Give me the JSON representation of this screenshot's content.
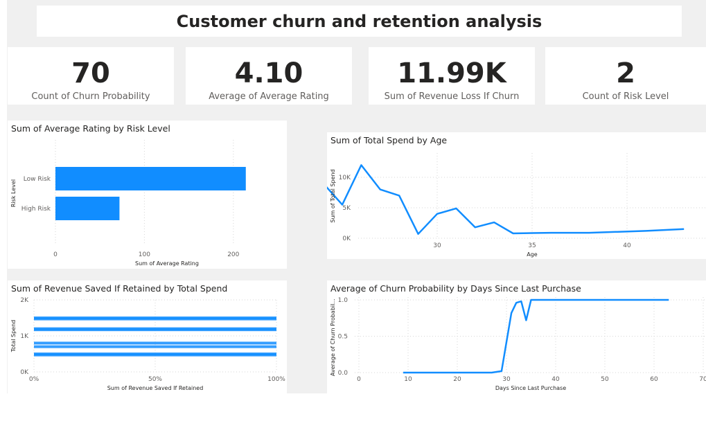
{
  "dashboard": {
    "title": "Customer churn and retention analysis",
    "kpis": [
      {
        "value": "70",
        "label": "Count of Churn Probability"
      },
      {
        "value": "4.10",
        "label": "Average of Average Rating"
      },
      {
        "value": "11.99K",
        "label": "Sum of Revenue Loss If Churn"
      },
      {
        "value": "2",
        "label": "Count of Risk Level"
      }
    ]
  },
  "colors": {
    "series": "#118dff",
    "background": "#f0f0f0",
    "card": "#ffffff",
    "title_text": "#252423",
    "label_text": "#605e5c"
  },
  "chart_data": [
    {
      "type": "bar",
      "orientation": "horizontal",
      "title": "Sum of Average Rating by Risk Level",
      "categories": [
        "Low Risk",
        "High Risk"
      ],
      "values": [
        214,
        72
      ],
      "xlabel": "Sum of Average Rating",
      "ylabel": "Risk Level",
      "xlim": [
        0,
        250
      ],
      "xticks": [
        "0",
        "100",
        "200"
      ],
      "grid": true
    },
    {
      "type": "line",
      "title": "Sum of Total Spend by Age",
      "x": [
        22,
        23,
        24,
        25,
        26,
        27,
        28,
        29,
        30,
        31,
        32,
        33,
        34,
        35,
        36,
        38,
        41,
        43
      ],
      "values": [
        1400,
        2800,
        9000,
        5500,
        12000,
        8000,
        7000,
        700,
        4000,
        4900,
        1800,
        2600,
        800,
        850,
        900,
        900,
        1200,
        1500
      ],
      "xlabel": "Age",
      "ylabel": "Sum of Total Spend",
      "xticks": [
        "30",
        "35",
        "40"
      ],
      "yticks": [
        "0K",
        "5K",
        "10K"
      ],
      "ylim": [
        0,
        12500
      ],
      "grid": true
    },
    {
      "type": "bar",
      "orientation": "horizontal",
      "stacked": "100%",
      "title": "Sum of Revenue Saved If Retained by Total Spend",
      "categories": [
        1500,
        1470,
        1200,
        1170,
        800,
        700,
        500,
        470
      ],
      "values": [
        100,
        100,
        100,
        100,
        100,
        100,
        100,
        100
      ],
      "xlabel": "Sum of Revenue Saved If Retained",
      "ylabel": "Total Spend",
      "xticks": [
        "0%",
        "50%",
        "100%"
      ],
      "yticks": [
        "0K",
        "1K",
        "2K"
      ],
      "ylim": [
        0,
        2000
      ],
      "grid": true
    },
    {
      "type": "line",
      "title": "Average of Churn Probability by Days Since Last Purchase",
      "x": [
        9,
        20,
        27,
        29,
        31,
        32,
        33,
        34,
        35,
        36,
        37,
        40,
        50,
        60,
        63
      ],
      "values": [
        0.0,
        0.0,
        0.0,
        0.02,
        0.82,
        0.96,
        0.98,
        0.72,
        1.0,
        1.0,
        1.0,
        1.0,
        1.0,
        1.0,
        1.0
      ],
      "xlabel": "Days Since Last Purchase",
      "ylabel": "Average of Churn Probabil...",
      "xticks": [
        "0",
        "10",
        "20",
        "30",
        "40",
        "50",
        "60",
        "70"
      ],
      "yticks": [
        "0.0",
        "0.5",
        "1.0"
      ],
      "ylim": [
        0,
        1
      ],
      "grid": true
    }
  ]
}
